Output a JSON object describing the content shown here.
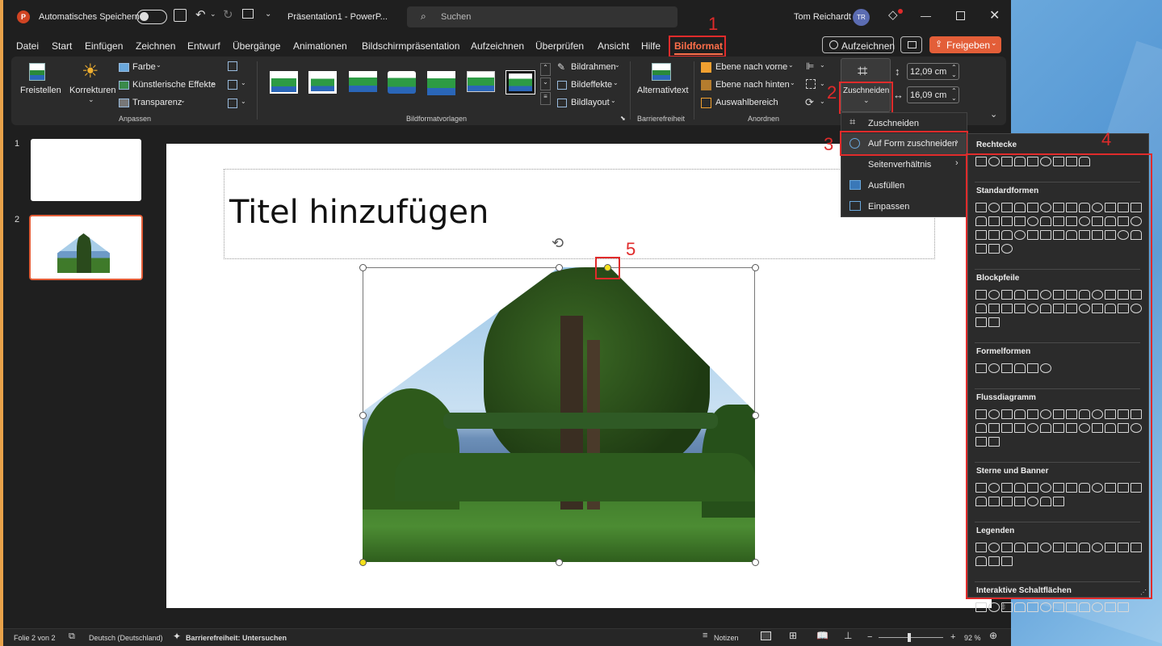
{
  "window": {
    "autosave_label": "Automatisches Speichern",
    "doc_title": "Präsentation1 - PowerP...",
    "search_placeholder": "Suchen",
    "user_name": "Tom Reichardt",
    "user_initials": "TR"
  },
  "menu": [
    "Datei",
    "Start",
    "Einfügen",
    "Zeichnen",
    "Entwurf",
    "Übergänge",
    "Animationen",
    "Bildschirmpräsentation",
    "Aufzeichnen",
    "Überprüfen",
    "Ansicht",
    "Hilfe",
    "Bildformat"
  ],
  "menu_right": {
    "record": "Aufzeichnen",
    "share": "Freigeben"
  },
  "ribbon": {
    "freistellen": "Freistellen",
    "korrekturen": "Korrekturen",
    "farbe": "Farbe",
    "kunst": "Künstlerische Effekte",
    "transparenz": "Transparenz",
    "group_anpassen": "Anpassen",
    "group_vorlagen": "Bildformatvorlagen",
    "bildrahmen": "Bildrahmen",
    "bildeffekte": "Bildeffekte",
    "bildlayout": "Bildlayout",
    "alternativtext": "Alternativtext",
    "group_barriere": "Barrierefreiheit",
    "ebene_vorne": "Ebene nach vorne",
    "ebene_hinten": "Ebene nach hinten",
    "auswahl": "Auswahlbereich",
    "group_anordnen": "Anordnen",
    "zuschneiden": "Zuschneiden",
    "height": "12,09 cm",
    "width": "16,09 cm"
  },
  "crop_menu": [
    "Zuschneiden",
    "Auf Form zuschneiden",
    "Seitenverhältnis",
    "Ausfüllen",
    "Einpassen"
  ],
  "shape_categories": [
    "Rechtecke",
    "Standardformen",
    "Blockpfeile",
    "Formelformen",
    "Flussdiagramm",
    "Sterne und Banner",
    "Legenden",
    "Interaktive Schaltflächen"
  ],
  "shape_counts": [
    9,
    42,
    28,
    6,
    28,
    20,
    16,
    12
  ],
  "slides": [
    "1",
    "2"
  ],
  "slide_title": "Titel hinzufügen",
  "annotations": [
    "1",
    "2",
    "3",
    "4",
    "5"
  ],
  "status": {
    "slide": "Folie 2 von 2",
    "language": "Deutsch (Deutschland)",
    "access": "Barrierefreiheit: Untersuchen",
    "notes": "Notizen",
    "zoom": "92 %"
  },
  "colors": {
    "accent": "#e35e38",
    "annotation": "#e02b2b",
    "sky": "#9cc7e8",
    "grass": "#3f7a2a"
  }
}
